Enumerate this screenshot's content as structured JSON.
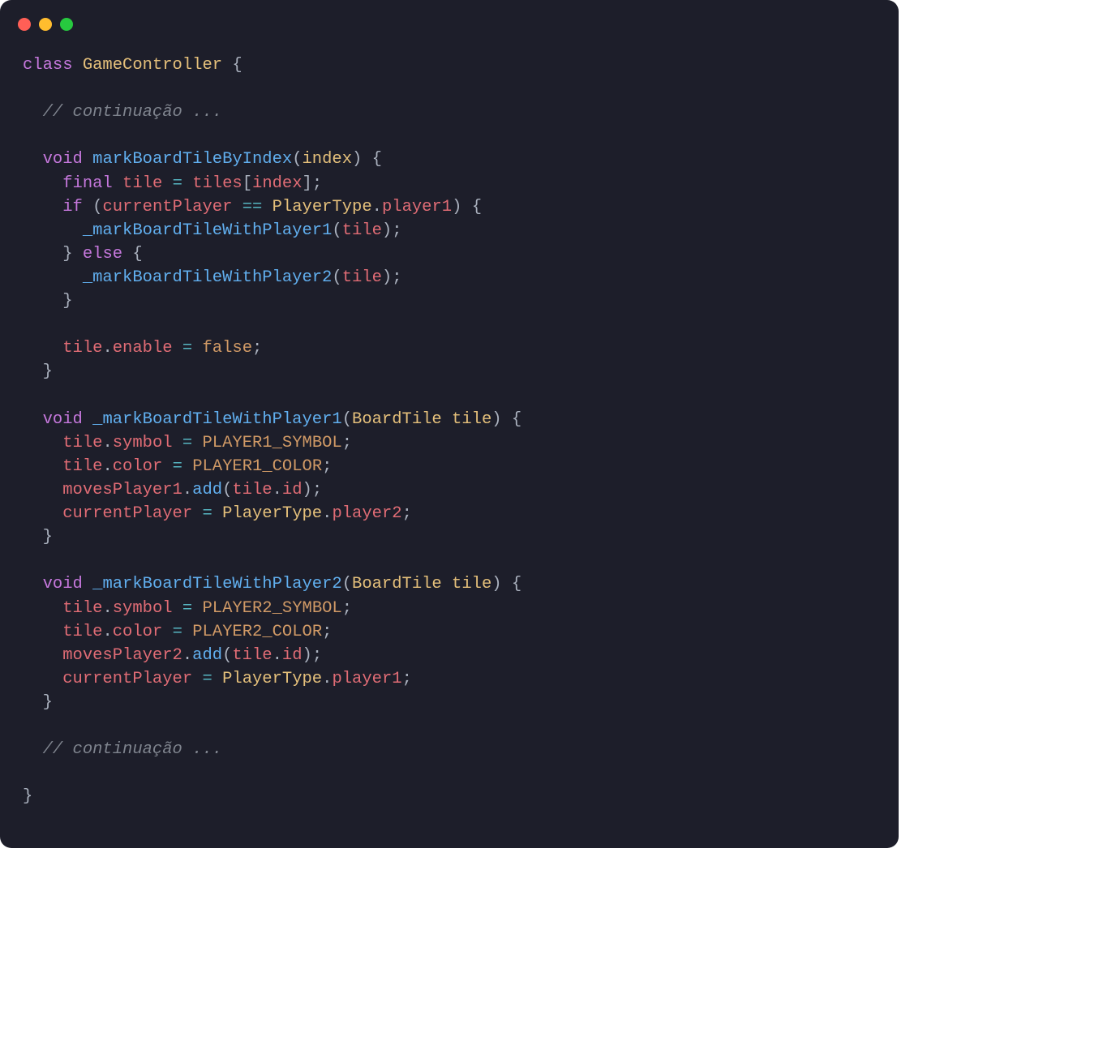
{
  "window": {
    "traffic_lights": [
      "close",
      "minimize",
      "zoom"
    ]
  },
  "code": {
    "language": "dart",
    "lines": [
      [
        {
          "c": "kw1",
          "t": "class"
        },
        {
          "c": "plain",
          "t": " "
        },
        {
          "c": "type",
          "t": "GameController"
        },
        {
          "c": "plain",
          "t": " "
        },
        {
          "c": "punc",
          "t": "{"
        }
      ],
      [],
      [
        {
          "c": "plain",
          "t": "  "
        },
        {
          "c": "comm",
          "t": "// continuação ..."
        }
      ],
      [],
      [
        {
          "c": "plain",
          "t": "  "
        },
        {
          "c": "kw1",
          "t": "void"
        },
        {
          "c": "plain",
          "t": " "
        },
        {
          "c": "fn",
          "t": "markBoardTileByIndex"
        },
        {
          "c": "punc",
          "t": "("
        },
        {
          "c": "param",
          "t": "index"
        },
        {
          "c": "punc",
          "t": ")"
        },
        {
          "c": "plain",
          "t": " "
        },
        {
          "c": "punc",
          "t": "{"
        }
      ],
      [
        {
          "c": "plain",
          "t": "    "
        },
        {
          "c": "kw1",
          "t": "final"
        },
        {
          "c": "plain",
          "t": " "
        },
        {
          "c": "ident",
          "t": "tile"
        },
        {
          "c": "plain",
          "t": " "
        },
        {
          "c": "op",
          "t": "="
        },
        {
          "c": "plain",
          "t": " "
        },
        {
          "c": "ident",
          "t": "tiles"
        },
        {
          "c": "punc",
          "t": "["
        },
        {
          "c": "ident",
          "t": "index"
        },
        {
          "c": "punc",
          "t": "];"
        }
      ],
      [
        {
          "c": "plain",
          "t": "    "
        },
        {
          "c": "kw1",
          "t": "if"
        },
        {
          "c": "plain",
          "t": " "
        },
        {
          "c": "punc",
          "t": "("
        },
        {
          "c": "ident",
          "t": "currentPlayer"
        },
        {
          "c": "plain",
          "t": " "
        },
        {
          "c": "op",
          "t": "=="
        },
        {
          "c": "plain",
          "t": " "
        },
        {
          "c": "type",
          "t": "PlayerType"
        },
        {
          "c": "punc",
          "t": "."
        },
        {
          "c": "prop",
          "t": "player1"
        },
        {
          "c": "punc",
          "t": ")"
        },
        {
          "c": "plain",
          "t": " "
        },
        {
          "c": "punc",
          "t": "{"
        }
      ],
      [
        {
          "c": "plain",
          "t": "      "
        },
        {
          "c": "fn",
          "t": "_markBoardTileWithPlayer1"
        },
        {
          "c": "punc",
          "t": "("
        },
        {
          "c": "ident",
          "t": "tile"
        },
        {
          "c": "punc",
          "t": ");"
        }
      ],
      [
        {
          "c": "plain",
          "t": "    "
        },
        {
          "c": "punc",
          "t": "}"
        },
        {
          "c": "plain",
          "t": " "
        },
        {
          "c": "kw1",
          "t": "else"
        },
        {
          "c": "plain",
          "t": " "
        },
        {
          "c": "punc",
          "t": "{"
        }
      ],
      [
        {
          "c": "plain",
          "t": "      "
        },
        {
          "c": "fn",
          "t": "_markBoardTileWithPlayer2"
        },
        {
          "c": "punc",
          "t": "("
        },
        {
          "c": "ident",
          "t": "tile"
        },
        {
          "c": "punc",
          "t": ");"
        }
      ],
      [
        {
          "c": "plain",
          "t": "    "
        },
        {
          "c": "punc",
          "t": "}"
        }
      ],
      [],
      [
        {
          "c": "plain",
          "t": "    "
        },
        {
          "c": "ident",
          "t": "tile"
        },
        {
          "c": "punc",
          "t": "."
        },
        {
          "c": "prop",
          "t": "enable"
        },
        {
          "c": "plain",
          "t": " "
        },
        {
          "c": "op",
          "t": "="
        },
        {
          "c": "plain",
          "t": " "
        },
        {
          "c": "const",
          "t": "false"
        },
        {
          "c": "punc",
          "t": ";"
        }
      ],
      [
        {
          "c": "plain",
          "t": "  "
        },
        {
          "c": "punc",
          "t": "}"
        }
      ],
      [],
      [
        {
          "c": "plain",
          "t": "  "
        },
        {
          "c": "kw1",
          "t": "void"
        },
        {
          "c": "plain",
          "t": " "
        },
        {
          "c": "fn",
          "t": "_markBoardTileWithPlayer1"
        },
        {
          "c": "punc",
          "t": "("
        },
        {
          "c": "type",
          "t": "BoardTile"
        },
        {
          "c": "plain",
          "t": " "
        },
        {
          "c": "param",
          "t": "tile"
        },
        {
          "c": "punc",
          "t": ")"
        },
        {
          "c": "plain",
          "t": " "
        },
        {
          "c": "punc",
          "t": "{"
        }
      ],
      [
        {
          "c": "plain",
          "t": "    "
        },
        {
          "c": "ident",
          "t": "tile"
        },
        {
          "c": "punc",
          "t": "."
        },
        {
          "c": "prop",
          "t": "symbol"
        },
        {
          "c": "plain",
          "t": " "
        },
        {
          "c": "op",
          "t": "="
        },
        {
          "c": "plain",
          "t": " "
        },
        {
          "c": "const",
          "t": "PLAYER1_SYMBOL"
        },
        {
          "c": "punc",
          "t": ";"
        }
      ],
      [
        {
          "c": "plain",
          "t": "    "
        },
        {
          "c": "ident",
          "t": "tile"
        },
        {
          "c": "punc",
          "t": "."
        },
        {
          "c": "prop",
          "t": "color"
        },
        {
          "c": "plain",
          "t": " "
        },
        {
          "c": "op",
          "t": "="
        },
        {
          "c": "plain",
          "t": " "
        },
        {
          "c": "const",
          "t": "PLAYER1_COLOR"
        },
        {
          "c": "punc",
          "t": ";"
        }
      ],
      [
        {
          "c": "plain",
          "t": "    "
        },
        {
          "c": "ident",
          "t": "movesPlayer1"
        },
        {
          "c": "punc",
          "t": "."
        },
        {
          "c": "fn",
          "t": "add"
        },
        {
          "c": "punc",
          "t": "("
        },
        {
          "c": "ident",
          "t": "tile"
        },
        {
          "c": "punc",
          "t": "."
        },
        {
          "c": "prop",
          "t": "id"
        },
        {
          "c": "punc",
          "t": ");"
        }
      ],
      [
        {
          "c": "plain",
          "t": "    "
        },
        {
          "c": "ident",
          "t": "currentPlayer"
        },
        {
          "c": "plain",
          "t": " "
        },
        {
          "c": "op",
          "t": "="
        },
        {
          "c": "plain",
          "t": " "
        },
        {
          "c": "type",
          "t": "PlayerType"
        },
        {
          "c": "punc",
          "t": "."
        },
        {
          "c": "prop",
          "t": "player2"
        },
        {
          "c": "punc",
          "t": ";"
        }
      ],
      [
        {
          "c": "plain",
          "t": "  "
        },
        {
          "c": "punc",
          "t": "}"
        }
      ],
      [],
      [
        {
          "c": "plain",
          "t": "  "
        },
        {
          "c": "kw1",
          "t": "void"
        },
        {
          "c": "plain",
          "t": " "
        },
        {
          "c": "fn",
          "t": "_markBoardTileWithPlayer2"
        },
        {
          "c": "punc",
          "t": "("
        },
        {
          "c": "type",
          "t": "BoardTile"
        },
        {
          "c": "plain",
          "t": " "
        },
        {
          "c": "param",
          "t": "tile"
        },
        {
          "c": "punc",
          "t": ")"
        },
        {
          "c": "plain",
          "t": " "
        },
        {
          "c": "punc",
          "t": "{"
        }
      ],
      [
        {
          "c": "plain",
          "t": "    "
        },
        {
          "c": "ident",
          "t": "tile"
        },
        {
          "c": "punc",
          "t": "."
        },
        {
          "c": "prop",
          "t": "symbol"
        },
        {
          "c": "plain",
          "t": " "
        },
        {
          "c": "op",
          "t": "="
        },
        {
          "c": "plain",
          "t": " "
        },
        {
          "c": "const",
          "t": "PLAYER2_SYMBOL"
        },
        {
          "c": "punc",
          "t": ";"
        }
      ],
      [
        {
          "c": "plain",
          "t": "    "
        },
        {
          "c": "ident",
          "t": "tile"
        },
        {
          "c": "punc",
          "t": "."
        },
        {
          "c": "prop",
          "t": "color"
        },
        {
          "c": "plain",
          "t": " "
        },
        {
          "c": "op",
          "t": "="
        },
        {
          "c": "plain",
          "t": " "
        },
        {
          "c": "const",
          "t": "PLAYER2_COLOR"
        },
        {
          "c": "punc",
          "t": ";"
        }
      ],
      [
        {
          "c": "plain",
          "t": "    "
        },
        {
          "c": "ident",
          "t": "movesPlayer2"
        },
        {
          "c": "punc",
          "t": "."
        },
        {
          "c": "fn",
          "t": "add"
        },
        {
          "c": "punc",
          "t": "("
        },
        {
          "c": "ident",
          "t": "tile"
        },
        {
          "c": "punc",
          "t": "."
        },
        {
          "c": "prop",
          "t": "id"
        },
        {
          "c": "punc",
          "t": ");"
        }
      ],
      [
        {
          "c": "plain",
          "t": "    "
        },
        {
          "c": "ident",
          "t": "currentPlayer"
        },
        {
          "c": "plain",
          "t": " "
        },
        {
          "c": "op",
          "t": "="
        },
        {
          "c": "plain",
          "t": " "
        },
        {
          "c": "type",
          "t": "PlayerType"
        },
        {
          "c": "punc",
          "t": "."
        },
        {
          "c": "prop",
          "t": "player1"
        },
        {
          "c": "punc",
          "t": ";"
        }
      ],
      [
        {
          "c": "plain",
          "t": "  "
        },
        {
          "c": "punc",
          "t": "}"
        }
      ],
      [],
      [
        {
          "c": "plain",
          "t": "  "
        },
        {
          "c": "comm",
          "t": "// continuação ..."
        }
      ],
      [],
      [
        {
          "c": "punc",
          "t": "}"
        }
      ]
    ]
  }
}
